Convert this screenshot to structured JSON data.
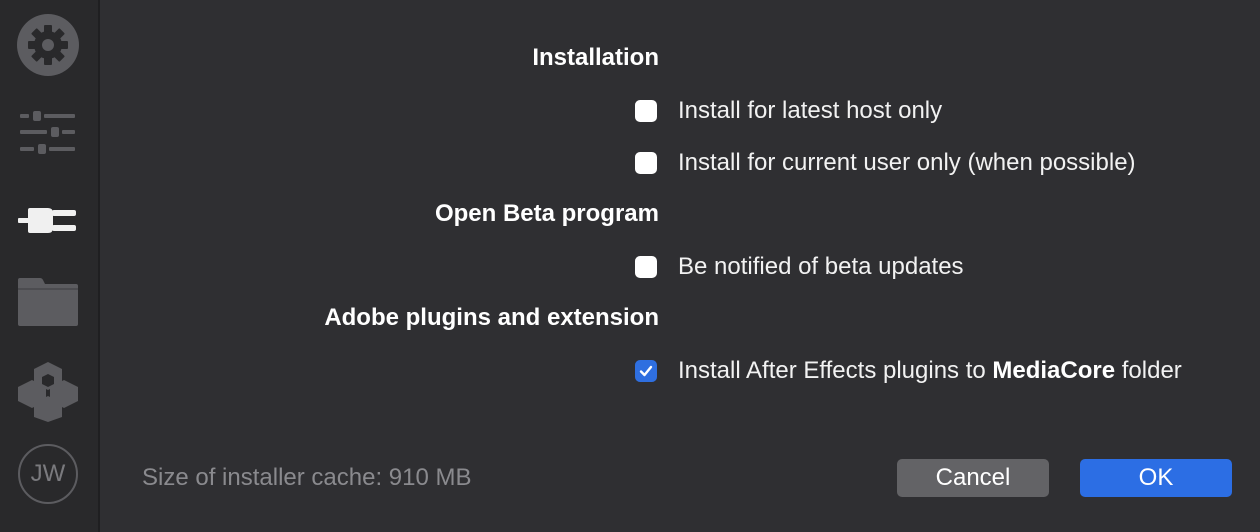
{
  "sidebar": {
    "items": [
      {
        "icon": "gear-icon"
      },
      {
        "icon": "sliders-icon"
      },
      {
        "icon": "plug-icon"
      },
      {
        "icon": "folder-icon"
      },
      {
        "icon": "cubes-icon"
      },
      {
        "icon": "avatar",
        "initials": "JW"
      }
    ]
  },
  "sections": {
    "installation": {
      "title": "Installation",
      "options": [
        {
          "label": "Install for latest host only",
          "checked": false
        },
        {
          "label": "Install for current user only (when possible)",
          "checked": false
        }
      ]
    },
    "beta": {
      "title": "Open Beta program",
      "options": [
        {
          "label": "Be notified of beta updates",
          "checked": false
        }
      ]
    },
    "adobe": {
      "title": "Adobe plugins and extension",
      "option": {
        "label_prefix": "Install After Effects plugins to ",
        "label_bold": "MediaCore",
        "label_suffix": " folder",
        "checked": true
      }
    }
  },
  "footer": {
    "cache_text": "Size of installer cache: 910 MB",
    "cancel_label": "Cancel",
    "ok_label": "OK"
  },
  "colors": {
    "accent": "#2c6ee4",
    "background": "#2f2f32",
    "sidebar": "#29292b"
  }
}
